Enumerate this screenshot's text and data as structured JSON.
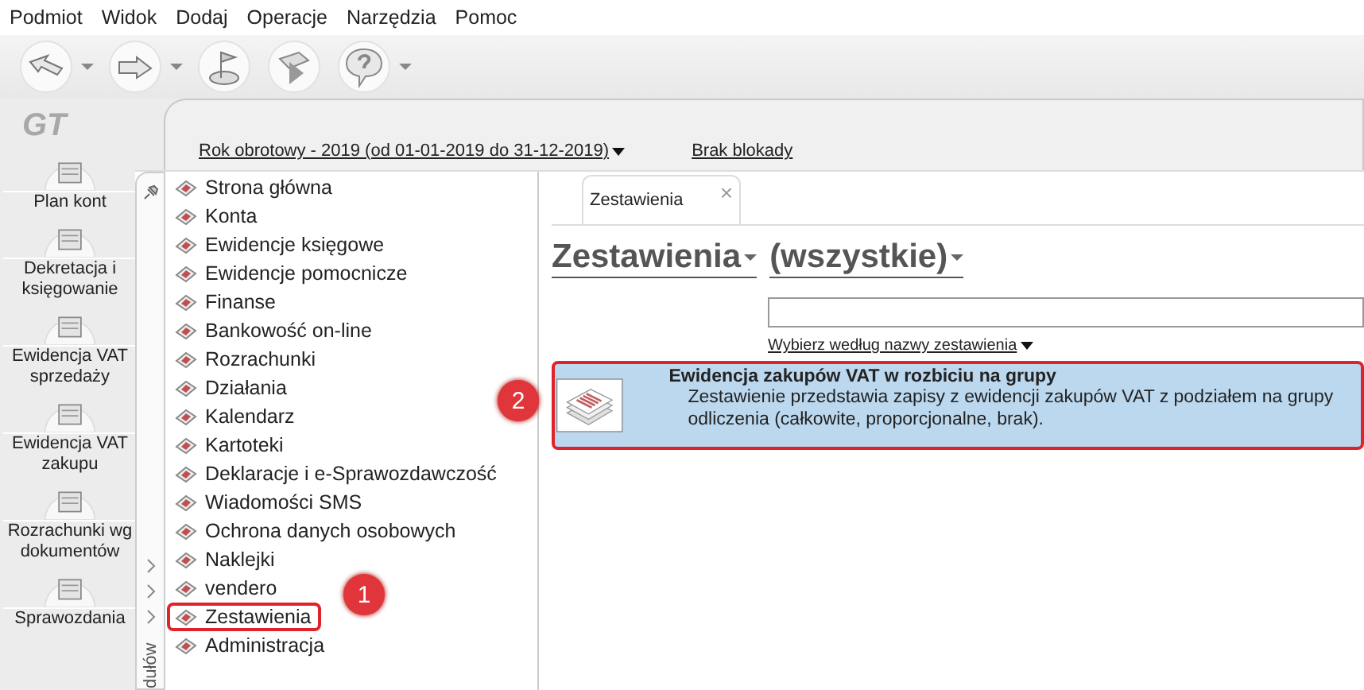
{
  "menu_bar": [
    "Podmiot",
    "Widok",
    "Dodaj",
    "Operacje",
    "Narzędzia",
    "Pomoc"
  ],
  "toolbar": [
    {
      "kind": "back",
      "dropdown": true
    },
    {
      "kind": "forward",
      "dropdown": true
    },
    {
      "kind": "flag",
      "dropdown": false
    },
    {
      "kind": "check",
      "dropdown": false
    },
    {
      "kind": "help",
      "dropdown": true
    }
  ],
  "logo": "GT",
  "shortcuts": [
    {
      "label": "Plan kont"
    },
    {
      "label": "Dekretacja i księgowanie"
    },
    {
      "label": "Ewidencja VAT sprzedaży"
    },
    {
      "label": "Ewidencja VAT zakupu"
    },
    {
      "label": "Rozrachunki wg dokumentów"
    },
    {
      "label": "Sprawozdania"
    }
  ],
  "header": {
    "fiscal_year": "Rok obrotowy - 2019  (od 01-01-2019 do 31-12-2019)",
    "lock": "Brak blokady"
  },
  "module_strip": {
    "label": "dułów"
  },
  "modules": [
    {
      "label": "Strona główna",
      "highlighted": false
    },
    {
      "label": "Konta",
      "highlighted": false
    },
    {
      "label": "Ewidencje księgowe",
      "highlighted": false
    },
    {
      "label": "Ewidencje pomocnicze",
      "highlighted": false
    },
    {
      "label": "Finanse",
      "highlighted": false
    },
    {
      "label": "Bankowość on-line",
      "highlighted": false
    },
    {
      "label": "Rozrachunki",
      "highlighted": false
    },
    {
      "label": "Działania",
      "highlighted": false
    },
    {
      "label": "Kalendarz",
      "highlighted": false
    },
    {
      "label": "Kartoteki",
      "highlighted": false
    },
    {
      "label": "Deklaracje i e-Sprawozdawczość",
      "highlighted": false
    },
    {
      "label": "Wiadomości SMS",
      "highlighted": false
    },
    {
      "label": "Ochrona danych osobowych",
      "highlighted": false
    },
    {
      "label": "Naklejki",
      "highlighted": false
    },
    {
      "label": "vendero",
      "highlighted": false
    },
    {
      "label": "Zestawienia",
      "highlighted": true,
      "badge": "1"
    },
    {
      "label": "Administracja",
      "highlighted": false
    }
  ],
  "tabs": [
    {
      "label": "Zestawienia",
      "selected": true,
      "close": "×"
    }
  ],
  "filters": [
    "Zestawienia",
    "(wszystkie)"
  ],
  "sort_link": "Wybierz według nazwy zestawienia",
  "reports": [
    {
      "title": "Ewidencja zakupów VAT w rozbiciu na grupy",
      "description": "Zestawienie przedstawia zapisy z ewidencji zakupów VAT z podziałem na grupy odliczenia (całkowite, proporcjonalne, brak).",
      "selected": true,
      "highlighted": true,
      "badge": "2"
    }
  ]
}
